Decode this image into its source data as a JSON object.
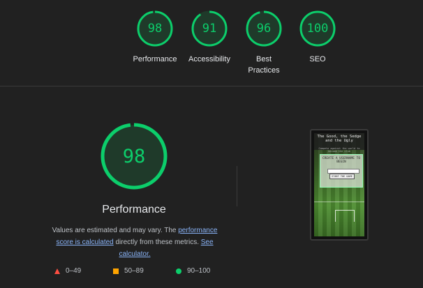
{
  "categories": [
    {
      "score": "98",
      "label": "Performance"
    },
    {
      "score": "91",
      "label": "Accessibility"
    },
    {
      "score": "96",
      "label": "Best Practices"
    },
    {
      "score": "100",
      "label": "SEO"
    }
  ],
  "main": {
    "score": "98",
    "title": "Performance",
    "note_part1": "Values are estimated and may vary. The ",
    "note_link1": "performance score is calculated",
    "note_part2": " directly from these metrics. ",
    "note_link2": "See calculator."
  },
  "legend": {
    "fail": "0–49",
    "average": "50–89",
    "pass": "90–100"
  },
  "screenshot": {
    "app_title": "The Good, the Sedge and the Ugly",
    "app_subtitle": "Compete against the world to become the club",
    "card_heading": "CREATE A USERNAME TO BEGIN",
    "card_button": "START THE GAME"
  },
  "colors": {
    "pass": "#0cce6b",
    "average": "#ffa400",
    "fail": "#ff4e42",
    "link": "#8ab4f8"
  }
}
